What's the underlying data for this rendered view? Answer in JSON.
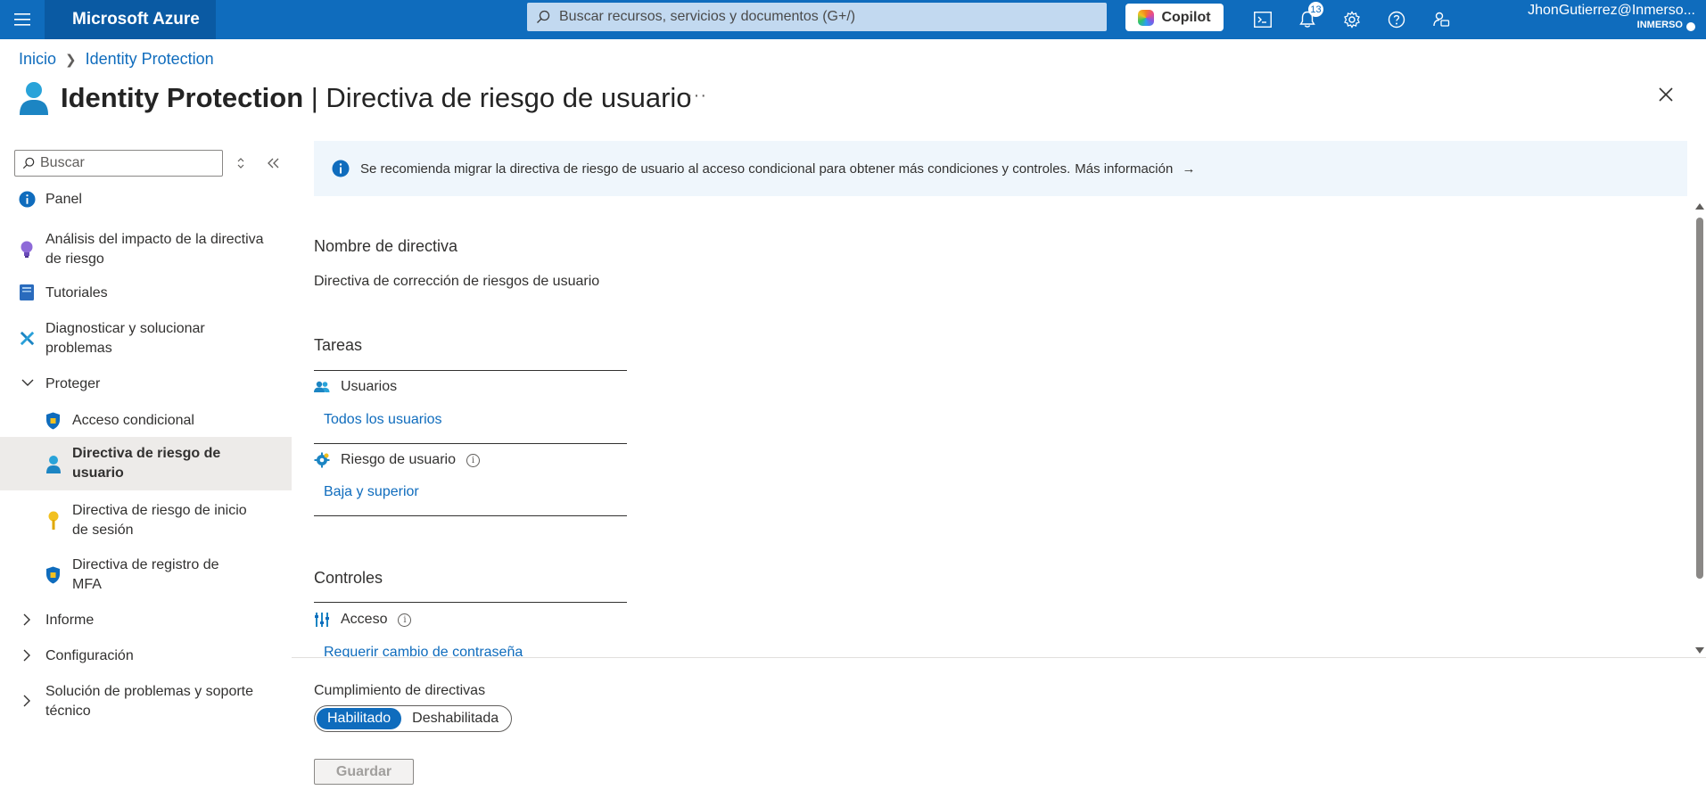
{
  "topbar": {
    "brand": "Microsoft Azure",
    "search_placeholder": "Buscar recursos, servicios y documentos (G+/)",
    "copilot_label": "Copilot",
    "notification_count": "13",
    "account_name": "JhonGutierrez@Inmerso...",
    "account_tenant": "INMERSO",
    "icons": [
      "menu-icon",
      "cloud-shell-icon",
      "bell-icon",
      "gear-icon",
      "help-icon",
      "feedback-icon"
    ]
  },
  "breadcrumb": [
    "Inicio",
    "Identity Protection"
  ],
  "header": {
    "service": "Identity Protection",
    "separator": " | ",
    "page": "Directiva de riesgo de usuario",
    "more": "···"
  },
  "sidebar": {
    "search_placeholder": "Buscar",
    "items": [
      {
        "label": "Panel",
        "icon": "info-icon"
      },
      {
        "label": "Análisis del impacto de la directiva de riesgo",
        "icon": "lightbulb-icon"
      },
      {
        "label": "Tutoriales",
        "icon": "book-icon"
      },
      {
        "label": "Diagnosticar y solucionar problemas",
        "icon": "wrench-icon"
      },
      {
        "label": "Proteger",
        "icon": "chevron-down-icon"
      },
      {
        "label": "Acceso condicional",
        "icon": "shield-icon"
      },
      {
        "label": "Directiva de riesgo de usuario",
        "icon": "user-icon"
      },
      {
        "label": "Directiva de riesgo de inicio de sesión",
        "icon": "key-icon"
      },
      {
        "label": "Directiva de registro de MFA",
        "icon": "shield-icon"
      },
      {
        "label": "Informe",
        "icon": "chevron-right-icon"
      },
      {
        "label": "Configuración",
        "icon": "chevron-right-icon"
      },
      {
        "label": "Solución de problemas y soporte técnico",
        "icon": "chevron-right-icon"
      }
    ]
  },
  "banner": {
    "text": "Se recomienda migrar la directiva de riesgo de usuario al acceso condicional para obtener más condiciones y controles.",
    "link": "Más información",
    "arrow": "→"
  },
  "policy": {
    "name_label": "Nombre de directiva",
    "name_value": "Directiva de corrección de riesgos de usuario",
    "tasks_label": "Tareas",
    "users_label": "Usuarios",
    "users_value": "Todos los usuarios",
    "risk_label": "Riesgo de usuario",
    "risk_value": "Baja y superior",
    "controls_label": "Controles",
    "access_label": "Acceso",
    "access_value": "Requerir cambio de contraseña"
  },
  "footer": {
    "enforcement_label": "Cumplimiento de directivas",
    "enabled": "Habilitado",
    "disabled": "Deshabilitada",
    "selected": "Habilitado",
    "save": "Guardar"
  },
  "colors": {
    "accent": "#0f6cbd",
    "selected_bg": "#edebe9",
    "banner_bg": "#eff6fc"
  }
}
